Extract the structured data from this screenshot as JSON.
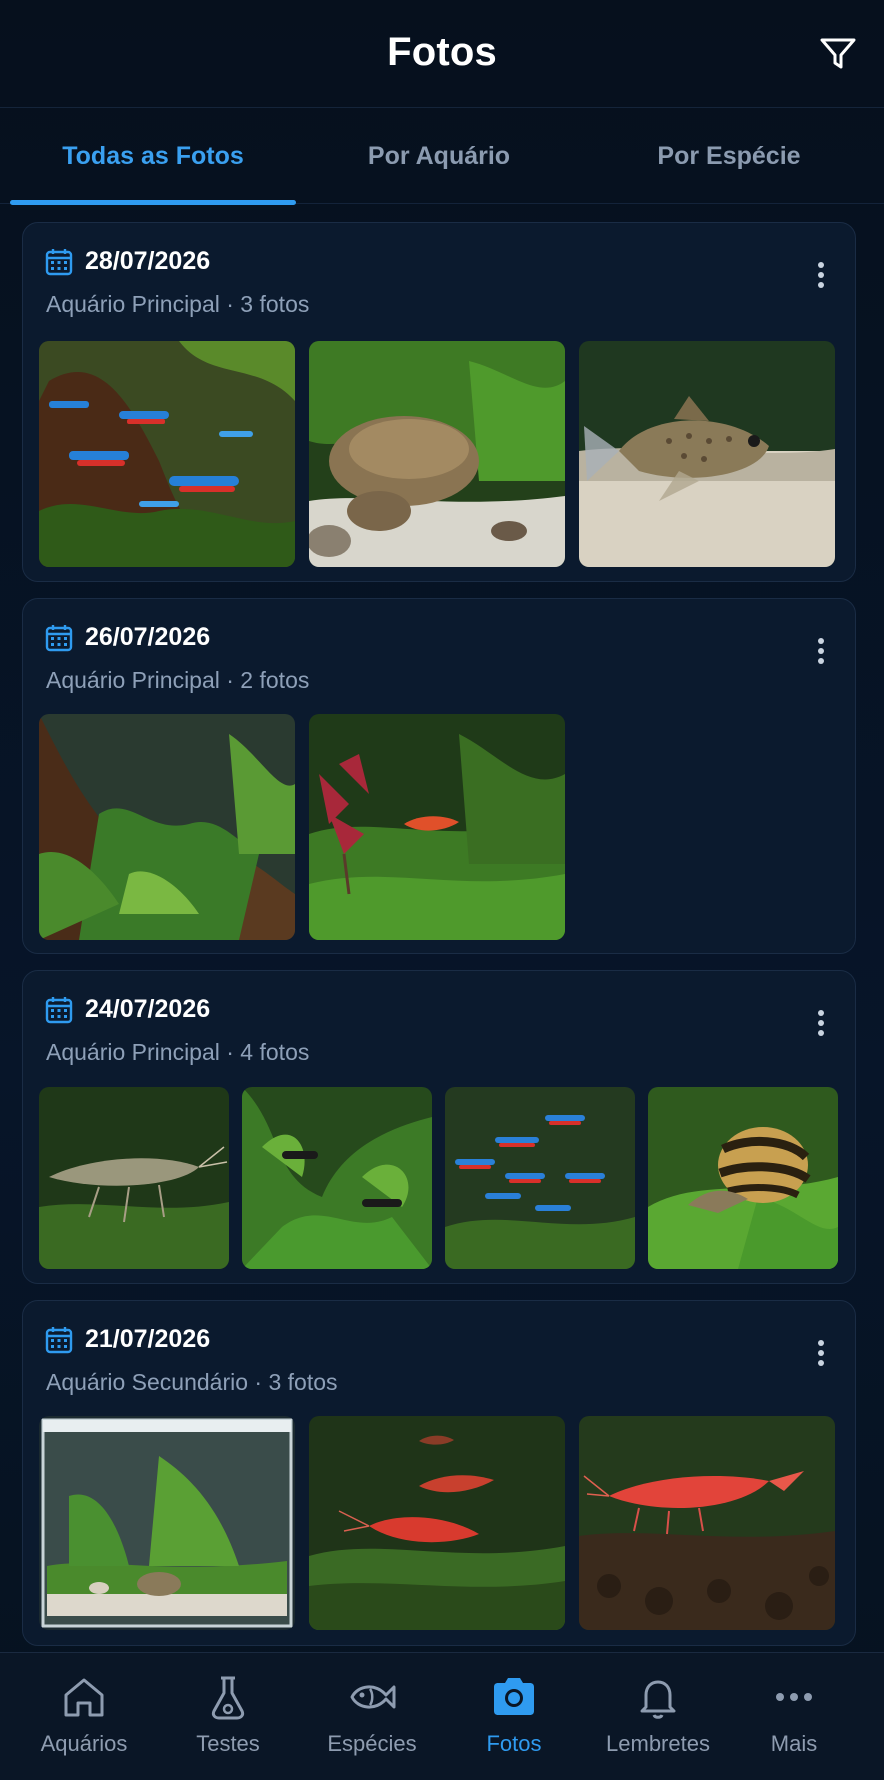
{
  "header": {
    "title": "Fotos",
    "filter_icon": "filter-icon"
  },
  "tabs": [
    {
      "label": "Todas as Fotos",
      "active": true
    },
    {
      "label": "Por Aquário",
      "active": false
    },
    {
      "label": "Por Espécie",
      "active": false
    }
  ],
  "groups": [
    {
      "date": "28/07/2026",
      "meta": "Aquário Principal · 3 fotos",
      "photos": [
        "neon tetras over driftwood",
        "rocks and plants on white sand",
        "corydoras catfish on sand"
      ]
    },
    {
      "date": "26/07/2026",
      "meta": "Aquário Principal · 2 fotos",
      "photos": [
        "driftwood with green plants",
        "red plant with cherry shrimp"
      ]
    },
    {
      "date": "24/07/2026",
      "meta": "Aquário Principal · 4 fotos",
      "photos": [
        "clear shrimp on moss",
        "plants with small fish",
        "school of neon tetras",
        "striped snail on leaf"
      ]
    },
    {
      "date": "21/07/2026",
      "meta": "Aquário Secundário  · 3 fotos",
      "photos": [
        "small planted tank",
        "red cherry shrimp on moss",
        "red cherry shrimp close-up"
      ]
    }
  ],
  "nav": [
    {
      "label": "Aquários",
      "icon": "home-icon",
      "active": false
    },
    {
      "label": "Testes",
      "icon": "flask-icon",
      "active": false
    },
    {
      "label": "Espécies",
      "icon": "fish-icon",
      "active": false
    },
    {
      "label": "Fotos",
      "icon": "camera-icon",
      "active": true
    },
    {
      "label": "Lembretes",
      "icon": "bell-icon",
      "active": false
    },
    {
      "label": "Mais",
      "icon": "more-icon",
      "active": false
    }
  ],
  "colors": {
    "accent": "#2f9bf0",
    "background": "#06111f",
    "card": "#0b1a2e",
    "muted": "#8ea0b8"
  }
}
